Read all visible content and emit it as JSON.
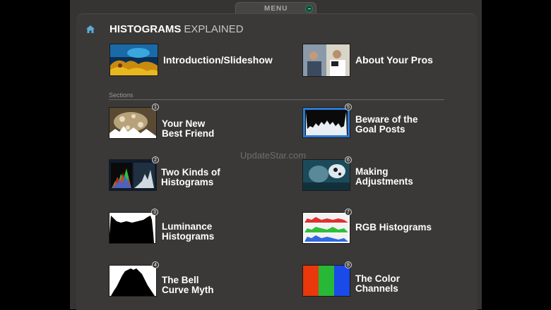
{
  "menu": {
    "label": "MENU"
  },
  "header": {
    "title_bold": "HISTOGRAMS",
    "title_light": "EXPLAINED"
  },
  "top_items": [
    {
      "label": "Introduction/Slideshow",
      "icon": "reef-photo"
    },
    {
      "label": "About Your Pros",
      "icon": "photographers-photo"
    }
  ],
  "sections": {
    "label": "Sections",
    "items": [
      {
        "number": "1",
        "line1": "Your New",
        "line2": "Best Friend"
      },
      {
        "number": "2",
        "line1": "Two Kinds of",
        "line2": "Histograms"
      },
      {
        "number": "3",
        "line1": "Luminance",
        "line2": "Histograms"
      },
      {
        "number": "4",
        "line1": "The Bell",
        "line2": "Curve Myth"
      },
      {
        "number": "5",
        "line1": "Beware of the",
        "line2": "Goal Posts"
      },
      {
        "number": "6",
        "line1": "Making",
        "line2": "Adjustments"
      },
      {
        "number": "7",
        "line1": "RGB Histograms",
        "line2": ""
      },
      {
        "number": "8",
        "line1": "The Color",
        "line2": "Channels"
      }
    ]
  },
  "watermark": "UpdateStar.com",
  "colors": {
    "panel": "#363432",
    "content": "#3b3937",
    "accent_menu": "#2c7a62"
  }
}
